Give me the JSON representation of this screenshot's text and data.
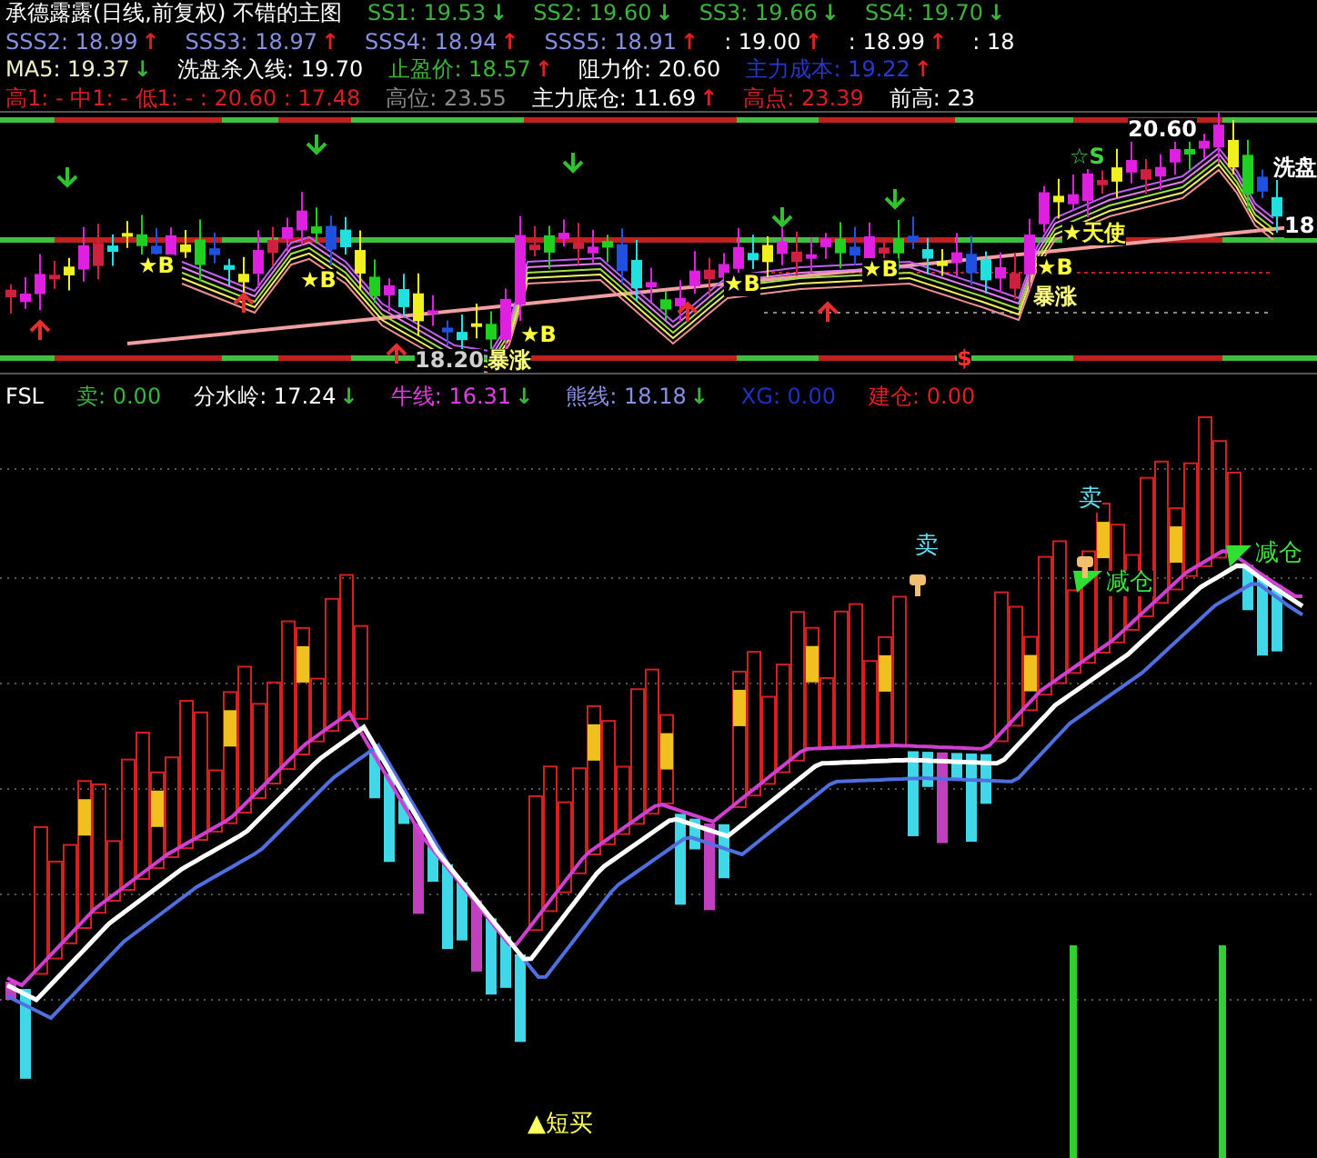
{
  "main_legend": {
    "rows": [
      [
        {
          "text": "承德露露(日线,前复权) 不错的主图",
          "color": "#ffffff"
        },
        {
          "text": "SS1: 19.53",
          "arrow": {
            "text": "↓",
            "color": "#3cb43c"
          },
          "color": "#3cb43c"
        },
        {
          "text": "SS2: 19.60",
          "arrow": {
            "text": "↓",
            "color": "#3cb43c"
          },
          "color": "#3cb43c"
        },
        {
          "text": "SS3: 19.66",
          "arrow": {
            "text": "↓",
            "color": "#3cb43c"
          },
          "color": "#3cb43c"
        },
        {
          "text": "SS4: 19.70",
          "arrow": {
            "text": "↓",
            "color": "#3cb43c"
          },
          "color": "#3cb43c"
        }
      ],
      [
        {
          "text": "SSS2: 18.99",
          "arrow": {
            "text": "↑",
            "color": "#e02020"
          },
          "color": "#8890e0"
        },
        {
          "text": "SSS3: 18.97",
          "arrow": {
            "text": "↑",
            "color": "#e02020"
          },
          "color": "#8890e0"
        },
        {
          "text": "SSS4: 18.94",
          "arrow": {
            "text": "↑",
            "color": "#e02020"
          },
          "color": "#8890e0"
        },
        {
          "text": "SSS5: 18.91",
          "arrow": {
            "text": "↑",
            "color": "#e02020"
          },
          "color": "#8890e0"
        },
        {
          "text": ": 19.00",
          "arrow": {
            "text": "↑",
            "color": "#e02020"
          },
          "color": "#ffffff"
        },
        {
          "text": ": 18.99",
          "arrow": {
            "text": "↑",
            "color": "#e02020"
          },
          "color": "#ffffff"
        },
        {
          "text": ": 18",
          "color": "#ffffff"
        }
      ],
      [
        {
          "text": "MA5: 19.37",
          "arrow": {
            "text": "↓",
            "color": "#3cb43c"
          },
          "color": "#f0f0c8"
        },
        {
          "text": "洗盘杀入线: 19.70",
          "color": "#ffffff"
        },
        {
          "text": "止盈价: 18.57",
          "arrow": {
            "text": "↑",
            "color": "#e02020"
          },
          "color": "#3cb43c"
        },
        {
          "text": "阻力价: 20.60",
          "color": "#ffffff"
        },
        {
          "text": "主力成本: 19.22",
          "arrow": {
            "text": "↑",
            "color": "#e02020"
          },
          "color": "#2838d0"
        }
      ],
      [
        {
          "text": "高1: - 中1: - 低1: - : 20.60 : 17.48",
          "color": "#d82020"
        },
        {
          "text": "高位: 23.55",
          "color": "#8a8a8a"
        },
        {
          "text": "主力底仓: 11.69",
          "arrow": {
            "text": "↑",
            "color": "#e02020"
          },
          "color": "#ffffff"
        },
        {
          "text": "高点: 23.39",
          "color": "#d82020"
        },
        {
          "text": "前高: 23",
          "color": "#ffffff"
        }
      ]
    ]
  },
  "main_chart": {
    "labels": [
      {
        "text": "★B",
        "color": "#ffff40"
      },
      {
        "text": "★B",
        "color": "#ffff40"
      },
      {
        "text": "★B",
        "color": "#ffff40"
      },
      {
        "text": "18.20",
        "color": "#d0d0d0"
      },
      {
        "text": "暴涨",
        "color": "#ffff80"
      },
      {
        "text": "★B",
        "color": "#ffff40"
      },
      {
        "text": "★B",
        "color": "#ffff40"
      },
      {
        "text": "★天使",
        "color": "#ffff40"
      },
      {
        "text": "★B",
        "color": "#ffff40"
      },
      {
        "text": "暴涨",
        "color": "#ffff80"
      },
      {
        "text": "20.60",
        "color": "#ffffff"
      },
      {
        "text": "☆S",
        "color": "#40d040"
      },
      {
        "text": "洗盘",
        "color": "#ffffff"
      },
      {
        "text": "18.",
        "color": "#ffffff"
      },
      {
        "text": "$",
        "color": "#ff3030"
      }
    ]
  },
  "sub_legend": {
    "items": [
      {
        "text": "FSL",
        "color": "#ffffff"
      },
      {
        "text": "卖: 0.00",
        "color": "#3cb43c"
      },
      {
        "text": "分水岭: 17.24",
        "arrow": {
          "text": "↓",
          "color": "#3cb43c"
        },
        "color": "#ffffff"
      },
      {
        "text": "牛线: 16.31",
        "arrow": {
          "text": "↓",
          "color": "#3cb43c"
        },
        "color": "#e040e0"
      },
      {
        "text": "熊线: 18.18",
        "arrow": {
          "text": "↓",
          "color": "#3cb43c"
        },
        "color": "#8890e0"
      },
      {
        "text": "XG: 0.00",
        "color": "#2030c0"
      },
      {
        "text": "建仓: 0.00",
        "color": "#e02020"
      }
    ]
  },
  "sub_chart": {
    "labels": [
      {
        "text": "卖",
        "color": "#60e0f0"
      },
      {
        "text": "卖",
        "color": "#60e0f0"
      },
      {
        "text": "减仓",
        "color": "#40e040"
      },
      {
        "text": "减仓",
        "color": "#40e040"
      },
      {
        "text": "▲短买",
        "color": "#ffff60"
      }
    ]
  }
}
